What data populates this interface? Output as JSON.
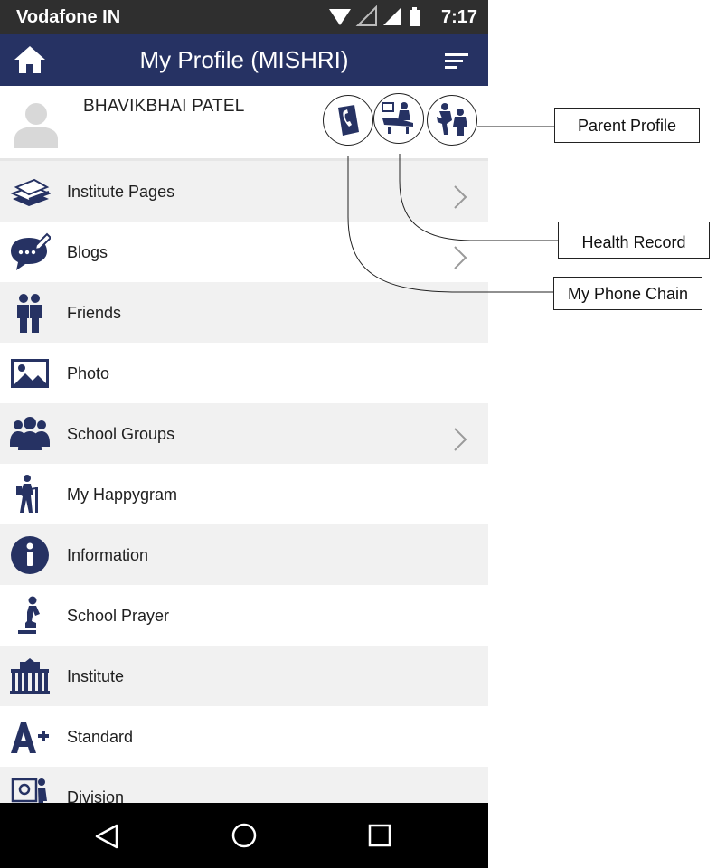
{
  "status_bar": {
    "carrier": "Vodafone IN",
    "time": "7:17"
  },
  "app_bar": {
    "title": "My Profile (MISHRI)",
    "home_icon": "home-icon",
    "menu_icon": "sort-menu-icon"
  },
  "profile": {
    "name": "BHAVIKBHAI PATEL",
    "quick_actions": [
      {
        "name": "phone-chain-icon"
      },
      {
        "name": "health-record-icon"
      },
      {
        "name": "parent-profile-icon"
      }
    ]
  },
  "menu": {
    "items": [
      {
        "label": "Institute Pages",
        "icon": "institute-pages-icon",
        "chevron": true
      },
      {
        "label": "Blogs",
        "icon": "blogs-icon",
        "chevron": true
      },
      {
        "label": "Friends",
        "icon": "friends-icon",
        "chevron": false
      },
      {
        "label": "Photo",
        "icon": "photo-icon",
        "chevron": false
      },
      {
        "label": "School Groups",
        "icon": "school-groups-icon",
        "chevron": true
      },
      {
        "label": "My Happygram",
        "icon": "happygram-icon",
        "chevron": false
      },
      {
        "label": "Information",
        "icon": "information-icon",
        "chevron": false
      },
      {
        "label": "School Prayer",
        "icon": "school-prayer-icon",
        "chevron": false
      },
      {
        "label": "Institute",
        "icon": "institute-icon",
        "chevron": false
      },
      {
        "label": "Standard",
        "icon": "standard-icon",
        "chevron": false
      },
      {
        "label": "Division",
        "icon": "division-icon",
        "chevron": false
      }
    ]
  },
  "annotations": {
    "parent_profile": "Parent Profile",
    "health_record": "Health Record",
    "my_phone_chain": "My Phone Chain"
  },
  "colors": {
    "app_bar": "#263263",
    "icon": "#263263",
    "status_bar": "#2f2f2f",
    "row_alt": "#f1f1f1"
  }
}
